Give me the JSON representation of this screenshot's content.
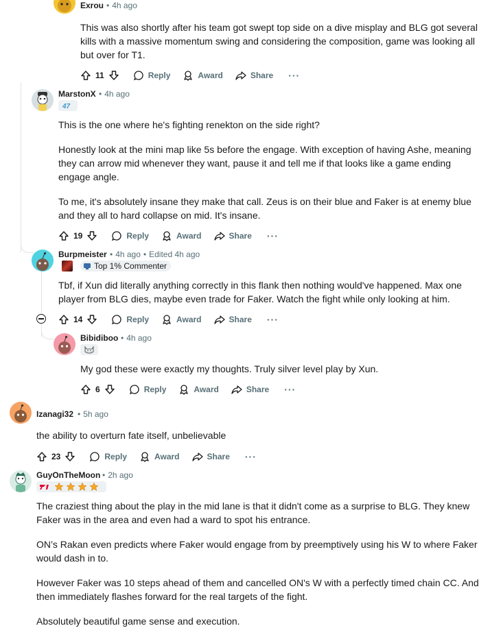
{
  "comments": [
    {
      "username": "Exrou",
      "time": "4h ago",
      "body": [
        "This was also shortly after his team got swept top side on a dive misplay and BLG got several kills with a massive momentum swing and considering the composition, game was looking all but over for T1."
      ],
      "votes": "11"
    },
    {
      "username": "MarstonX",
      "time": "4h ago",
      "flair_text": "",
      "body": [
        "This is the one where he's fighting renekton on the side right?",
        "Honestly look at the mini map like 5s before the engage. With exception of having Ashe, meaning they can arrow mid whenever they want, pause it and tell me if that looks like a game ending engage angle.",
        "To me, it's absolutely insane they make that call. Zeus is on their blue and Faker is at enemy blue and they all to hard collapse on mid. It's insane."
      ],
      "votes": "19"
    },
    {
      "username": "Burpmeister",
      "time": "4h ago",
      "edited": "Edited 4h ago",
      "flair_text": "Top 1% Commenter",
      "body": [
        "Tbf, if Xun did literally anything correctly in this flank then nothing would've happened. Max one player from BLG dies, maybe even trade for Faker. Watch the fight while only looking at him."
      ],
      "votes": "14"
    },
    {
      "username": "Bibidiboo",
      "time": "4h ago",
      "body": [
        "My god these were exactly my thoughts. Truly silver level play by Xun."
      ],
      "votes": "6"
    },
    {
      "username": "Izanagi32",
      "time": "5h ago",
      "body": [
        "the ability to overturn fate itself, unbelievable"
      ],
      "votes": "23"
    },
    {
      "username": "GuyOnTheMoon",
      "time": "2h ago",
      "body": [
        "The craziest thing about the play in the mid lane is that it didn't come as a surprise to BLG. They knew Faker was in the area and even had a ward to spot his entrance.",
        "ON’s Rakan even predicts where Faker would engage from by preemptively using his W to where Faker would dash in to.",
        "However Faker was 10 steps ahead of them and cancelled ON's W with a perfectly timed chain CC. And then immediately flashes forward for the real targets of the fight.",
        "Absolutely beautiful game sense and execution."
      ]
    }
  ],
  "actions": {
    "reply": "Reply",
    "award": "Award",
    "share": "Share",
    "more": "···"
  },
  "sep": "•",
  "colors": {
    "meta": "#576f76",
    "text": "#1a1a1b",
    "thread_line": "#e0e3e6"
  }
}
